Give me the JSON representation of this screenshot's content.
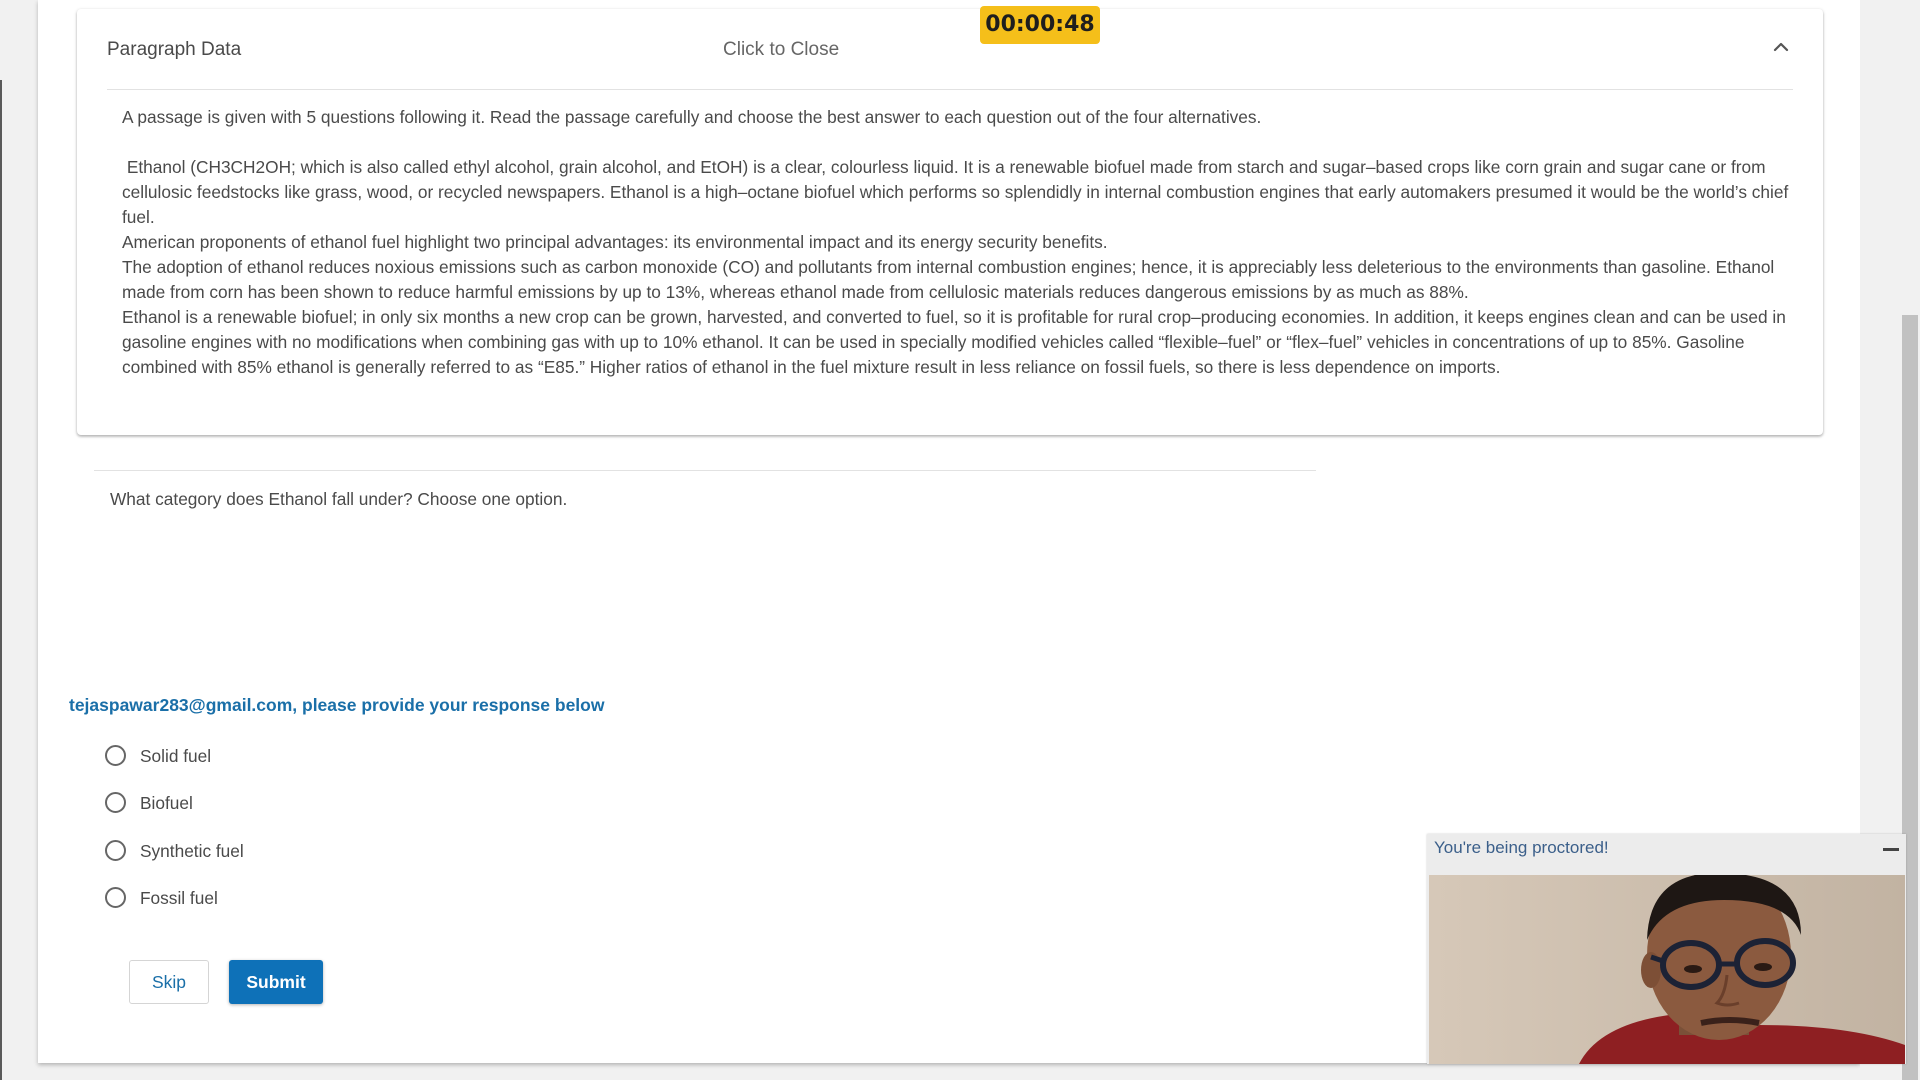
{
  "timer": {
    "value": "00:00:48"
  },
  "paragraph_panel": {
    "title": "Paragraph Data",
    "close_label": "Click to Close",
    "intro": "A passage is given with 5 questions following it. Read the passage carefully and choose the best answer to each question out of the four alternatives.",
    "paragraphs": [
      " Ethanol (CH3CH2OH; which is also called ethyl alcohol, grain alcohol, and EtOH) is a clear, colourless liquid. It is a renewable biofuel made from starch and sugar–based crops like corn grain and sugar cane or from cellulosic feedstocks like grass, wood, or recycled newspapers. Ethanol is a high–octane biofuel which performs so splendidly in internal combustion engines that early automakers presumed it would be the world’s chief fuel.",
      "American proponents of ethanol fuel highlight two principal advantages: its environmental impact and its energy security benefits.",
      "The adoption of ethanol reduces noxious emissions such as carbon monoxide (CO) and pollutants from internal combustion engines; hence, it is appreciably less deleterious to the environments than gasoline. Ethanol made from corn has been shown to reduce harmful emissions by up to 13%, whereas ethanol made from cellulosic materials reduces dangerous emissions by as much as 88%.",
      "Ethanol is a renewable biofuel; in only six months a new crop can be grown, harvested, and converted to fuel, so it is profitable for rural crop–producing economies. In addition, it keeps engines clean and can be used in gasoline engines with no modifications when combining gas with up to 10% ethanol. It can be used in specially modified vehicles called “flexible–fuel” or “flex–fuel” vehicles in concentrations of up to 85%. Gasoline combined with 85% ethanol is generally referred to as “E85.” Higher ratios of ethanol in the fuel mixture result in less reliance on fossil fuels, so there is less dependence on imports."
    ]
  },
  "question": {
    "text": "What category does Ethanol fall under? Choose one option.",
    "prompt": "tejaspawar283@gmail.com, please provide your response below",
    "options": [
      "Solid fuel",
      "Biofuel",
      "Synthetic fuel",
      "Fossil fuel"
    ]
  },
  "actions": {
    "skip_label": "Skip",
    "submit_label": "Submit"
  },
  "proctor": {
    "title": "You're being proctored!"
  },
  "colors": {
    "accent": "#0e71b8",
    "timer_bg": "#f5bf1a",
    "prompt_text": "#1a6fa8"
  }
}
